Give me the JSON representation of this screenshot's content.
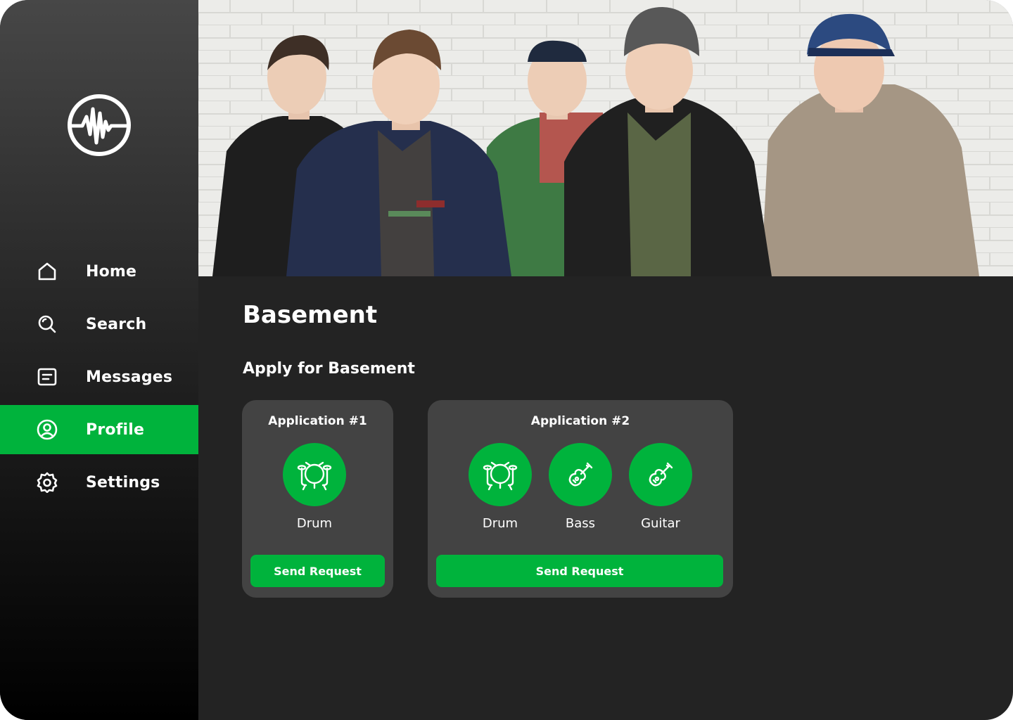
{
  "nav": {
    "items": [
      {
        "label": "Home",
        "icon": "home-icon"
      },
      {
        "label": "Search",
        "icon": "search-icon"
      },
      {
        "label": "Messages",
        "icon": "messages-icon"
      },
      {
        "label": "Profile",
        "icon": "profile-icon",
        "active": true
      },
      {
        "label": "Settings",
        "icon": "settings-icon"
      }
    ]
  },
  "band": {
    "name": "Basement",
    "apply_heading": "Apply for Basement"
  },
  "applications": [
    {
      "title": "Application #1",
      "instruments": [
        {
          "label": "Drum",
          "icon": "drum-icon"
        }
      ],
      "button": "Send Request"
    },
    {
      "title": "Application #2",
      "instruments": [
        {
          "label": "Drum",
          "icon": "drum-icon"
        },
        {
          "label": "Bass",
          "icon": "guitar-icon"
        },
        {
          "label": "Guitar",
          "icon": "guitar-icon"
        }
      ],
      "button": "Send Request"
    }
  ],
  "colors": {
    "accent": "#00b33c",
    "background": "#232323",
    "card": "#434343",
    "text": "#ffffff"
  }
}
